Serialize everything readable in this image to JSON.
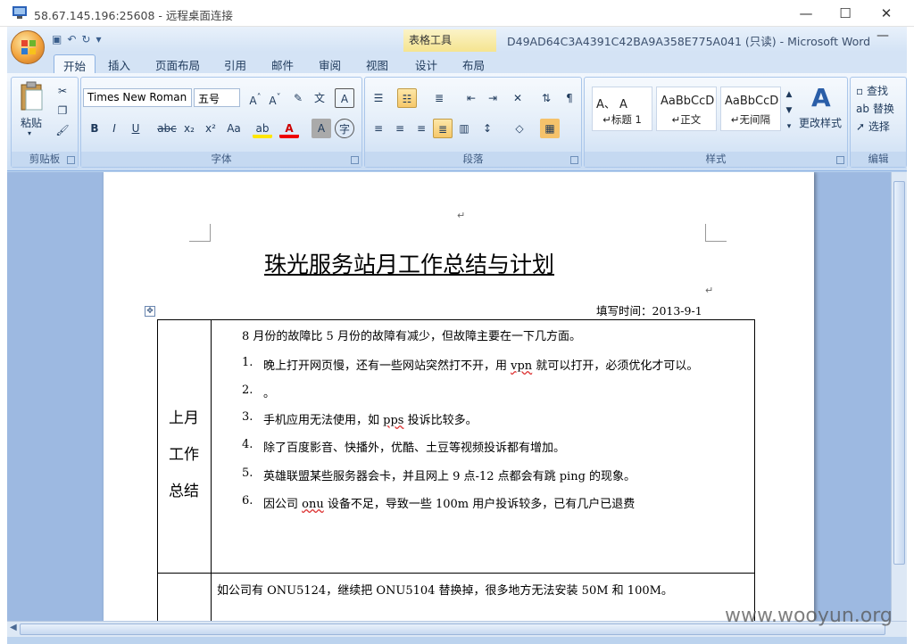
{
  "rdp": {
    "title": "58.67.145.196:25608 - 远程桌面连接",
    "min_glyph": "—",
    "max_glyph": "☐",
    "close_glyph": "✕"
  },
  "word": {
    "doc_title": "D49AD64C3A4391C42BA9A358E775A041 (只读) - Microsoft Word",
    "context_tab_group": "表格工具",
    "tabs": [
      "开始",
      "插入",
      "页面布局",
      "引用",
      "邮件",
      "审阅",
      "视图",
      "设计",
      "布局"
    ],
    "active_tab": "开始",
    "groups": {
      "clipboard": {
        "label": "剪贴板",
        "paste": "粘贴"
      },
      "font": {
        "label": "字体",
        "font_name": "Times New Roman",
        "font_size": "五号"
      },
      "paragraph": {
        "label": "段落"
      },
      "styles": {
        "label": "样式",
        "items": [
          {
            "sample": "A、 A",
            "name": "↵标题 1"
          },
          {
            "sample": "AaBbCcD",
            "name": "↵正文"
          },
          {
            "sample": "AaBbCcD",
            "name": "↵无间隔"
          }
        ],
        "change_styles": "更改样式"
      },
      "editing": {
        "label": "编辑",
        "find": "查找",
        "replace": "替换",
        "select": "选择"
      }
    }
  },
  "document": {
    "title": "珠光服务站月工作总结与计划",
    "fill_time": "填写时间：2013-9-1",
    "row1_header": [
      "上月",
      "工作",
      "总结"
    ],
    "intro": "8 月份的故障比 5 月份的故障有减少，但故障主要在一下几方面。",
    "items": [
      {
        "num": "1.",
        "text_a": "晚上打开网页慢，还有一些网站突然打不开，用 ",
        "wavy": "vpn",
        "text_b": " 就可以打开，必须优化才可以。"
      },
      {
        "num": "2.",
        "text_a": "。",
        "wavy": "",
        "text_b": ""
      },
      {
        "num": "3.",
        "text_a": "手机应用无法使用，如 ",
        "wavy": "pps",
        "text_b": " 投诉比较多。"
      },
      {
        "num": "4.",
        "text_a": "除了百度影音、快播外，优酷、土豆等视频投诉都有增加。",
        "wavy": "",
        "text_b": ""
      },
      {
        "num": "5.",
        "text_a": "英雄联盟某些服务器会卡，并且网上 9 点-12 点都会有跳 ping 的现象。",
        "wavy": "",
        "text_b": ""
      },
      {
        "num": "6.",
        "text_a": "因公司 ",
        "wavy": "onu",
        "text_b": " 设备不足，导致一些 100m 用户投诉较多，已有几户已退费"
      }
    ],
    "row2_text": "如公司有 ONU5124，继续把 ONU5104 替换掉，很多地方无法安装 50M 和 100M。",
    "para_mark": "↵"
  },
  "watermark": "www.wooyun.org"
}
